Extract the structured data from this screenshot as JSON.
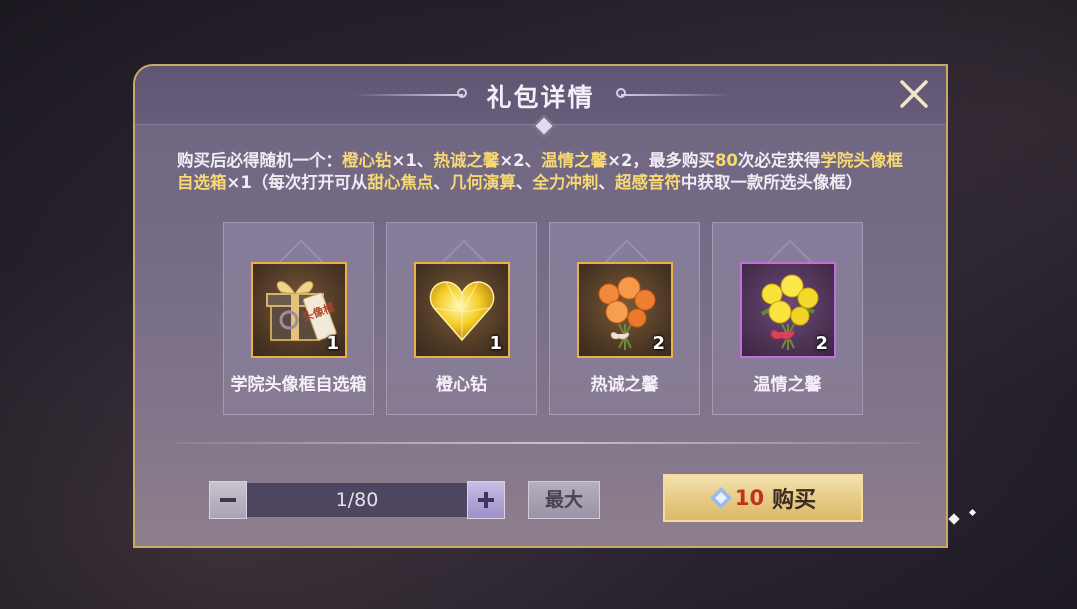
{
  "dialog": {
    "title": "礼包详情",
    "close_icon": "close-icon",
    "description": {
      "t1": "购买后必得随机一个：",
      "h1": "橙心钻",
      "t2": "×1、",
      "h2": "热诚之馨",
      "t3": "×2、",
      "h3": "温情之馨",
      "t4": "×2，最多购买",
      "h4": "80",
      "t5": "次必定获得",
      "h5": "学院头像框自选箱",
      "t6": "×1（每次打开可从",
      "h6": "甜心焦点",
      "t7": "、",
      "h7": "几何演算",
      "t8": "、",
      "h8": "全力冲刺",
      "t9": "、",
      "h9": "超感音符",
      "t10": "中获取一款所选头像框）"
    },
    "items": [
      {
        "name": "学院头像框自选箱",
        "qty": "1",
        "icon": "gift-box-icon",
        "frame_color": "#e8b248",
        "tag": "头像框"
      },
      {
        "name": "橙心钻",
        "qty": "1",
        "icon": "heart-diamond-icon",
        "frame_color": "#e8b248"
      },
      {
        "name": "热诚之馨",
        "qty": "2",
        "icon": "orange-rose-bouquet-icon",
        "frame_color": "#e8b248"
      },
      {
        "name": "温情之馨",
        "qty": "2",
        "icon": "yellow-rose-bouquet-icon",
        "frame_color": "#c46fe0"
      }
    ],
    "quantity": {
      "value": "1/80",
      "minus_icon": "minus-icon",
      "plus_icon": "plus-icon"
    },
    "max_label": "最大",
    "buy": {
      "price": "10",
      "label": "购买",
      "currency_icon": "diamond-gem-icon"
    },
    "colors": {
      "highlight": "#f7d873",
      "price": "#c2311e",
      "gold_frame": "#e8b248",
      "purple_frame": "#c46fe0"
    }
  }
}
